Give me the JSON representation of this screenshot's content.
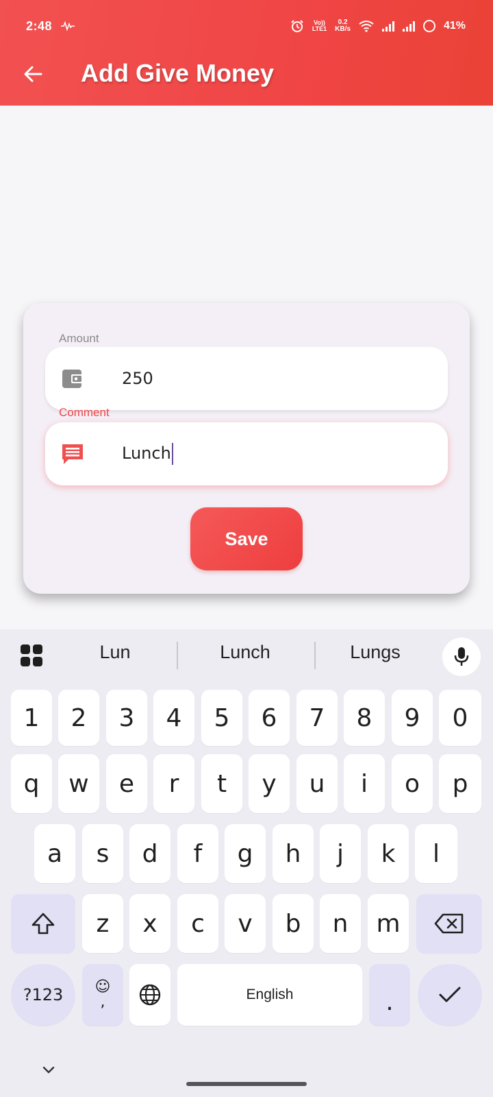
{
  "status_bar": {
    "time": "2:48",
    "lte_top": "Vo))",
    "lte_bottom": "LTE1",
    "speed_value": "0.2",
    "speed_unit": "KB/s",
    "battery": "41%"
  },
  "app_bar": {
    "title": "Add Give Money",
    "back_icon": "arrow-left-icon",
    "color": "#f04848"
  },
  "form": {
    "amount": {
      "label": "Amount",
      "value": "250",
      "icon": "wallet-icon"
    },
    "comment": {
      "label": "Comment",
      "value": "Lunch",
      "icon": "comment-icon",
      "focused": true
    },
    "save_label": "Save",
    "accent": "#ef4444"
  },
  "keyboard": {
    "suggestions": [
      "Lun",
      "Lunch",
      "Lungs"
    ],
    "row_numbers": [
      "1",
      "2",
      "3",
      "4",
      "5",
      "6",
      "7",
      "8",
      "9",
      "0"
    ],
    "row_q": [
      "q",
      "w",
      "e",
      "r",
      "t",
      "y",
      "u",
      "i",
      "o",
      "p"
    ],
    "row_a": [
      "a",
      "s",
      "d",
      "f",
      "g",
      "h",
      "j",
      "k",
      "l"
    ],
    "row_z": [
      "z",
      "x",
      "c",
      "v",
      "b",
      "n",
      "m"
    ],
    "symbols_label": "?123",
    "emoji_label": "☺",
    "comma_label": ",",
    "space_label": "English",
    "period_label": "."
  }
}
